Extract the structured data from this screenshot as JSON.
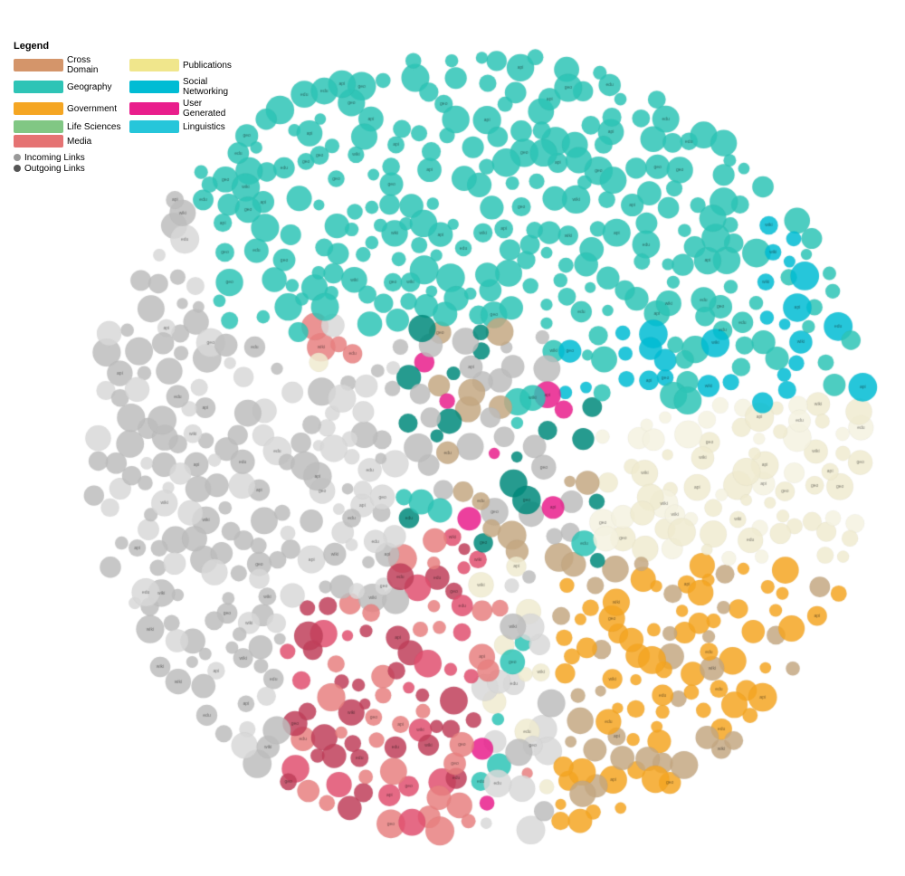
{
  "legend": {
    "title": "Legend",
    "items": [
      {
        "label": "Cross Domain",
        "color": "#E8A05A",
        "col": 0
      },
      {
        "label": "Publications",
        "color": "#F5E6A3",
        "col": 1
      },
      {
        "label": "Geography",
        "color": "#3BBFA0",
        "col": 0
      },
      {
        "label": "Social Networking",
        "color": "#2EC4B6",
        "col": 1
      },
      {
        "label": "Government",
        "color": "#F5A623",
        "col": 0
      },
      {
        "label": "User Generated",
        "color": "#E91E8C",
        "col": 1
      },
      {
        "label": "Life Sciences",
        "color": "#7BC67E",
        "col": 0
      },
      {
        "label": "Linguistics",
        "color": "#26C6DA",
        "col": 0
      },
      {
        "label": "Media",
        "color": "#F06292",
        "col": 0
      }
    ],
    "links": [
      {
        "label": "Incoming Links",
        "color": "#999"
      },
      {
        "label": "Outgoing Links",
        "color": "#555"
      }
    ]
  },
  "colors": {
    "cross_domain": "#D4956A",
    "publications": "#F0E68C",
    "geography": "#2EC4B6",
    "social_networking": "#00BCD4",
    "government": "#F5A623",
    "user_generated": "#E91E8C",
    "life_sciences": "#81C784",
    "linguistics": "#26C6DA",
    "media": "#E57373",
    "gray": "#BDBDBD",
    "light_gray": "#E0E0E0",
    "tan": "#C4A882",
    "dark_teal": "#00897B",
    "salmon": "#E88080",
    "pink_red": "#E05070",
    "orange": "#F5A623",
    "cream": "#F5F0DC"
  }
}
